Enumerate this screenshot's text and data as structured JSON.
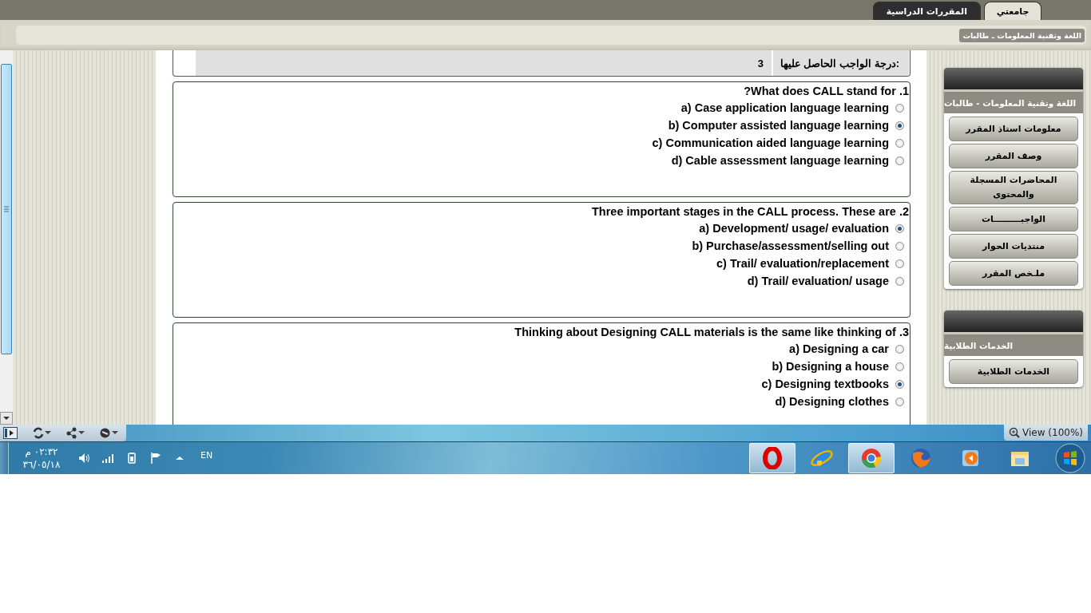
{
  "top_tabs": [
    {
      "label": "جامعتي",
      "selected": true
    },
    {
      "label": "المقررات الدراسية",
      "selected": false
    }
  ],
  "breadcrumb": "اللغة وتقنية المعلومات ـ طالبات",
  "grade": {
    "label": "درجة الواجب الحاصل عليها:",
    "value": "3"
  },
  "questions": [
    {
      "text": "1. What does CALL stand for?",
      "options": [
        {
          "label": "a) Case application language learning",
          "selected": false
        },
        {
          "label": "b) Computer assisted language learning",
          "selected": true
        },
        {
          "label": "c) Communication aided language learning",
          "selected": false
        },
        {
          "label": "d) Cable assessment language learning",
          "selected": false
        }
      ]
    },
    {
      "text": "2. Three important stages in the CALL process. These are",
      "options": [
        {
          "label": "a) Development/ usage/ evaluation",
          "selected": true
        },
        {
          "label": "b) Purchase/assessment/selling out",
          "selected": false
        },
        {
          "label": "c) Trail/ evaluation/replacement",
          "selected": false
        },
        {
          "label": "d) Trail/ evaluation/ usage",
          "selected": false
        }
      ]
    },
    {
      "text": "3. Thinking about Designing CALL materials is the same like thinking of",
      "options": [
        {
          "label": "a) Designing a car",
          "selected": false
        },
        {
          "label": "b) Designing a house",
          "selected": false
        },
        {
          "label": "c) Designing textbooks",
          "selected": true
        },
        {
          "label": "d) Designing clothes",
          "selected": false
        }
      ]
    }
  ],
  "sidebar": [
    {
      "title": "اللغة وتقنية المعلومات - طالبات",
      "items": [
        "معلومات استاذ المقرر",
        "وصف المقرر",
        "المحاضرات المسجلة والمحتوى",
        "الواجبـــــــــات",
        "منتديات الحوار",
        "ملـخص المقرر"
      ]
    },
    {
      "title": "الخدمات الطلابية",
      "items": [
        "الخدمات الطلابية"
      ]
    }
  ],
  "media_bar": {
    "view_button": "View (100%)"
  },
  "taskbar": {
    "time": "٠٢:٣٢ م",
    "date": "٣٦/٠٥/١٨",
    "language": "EN"
  }
}
